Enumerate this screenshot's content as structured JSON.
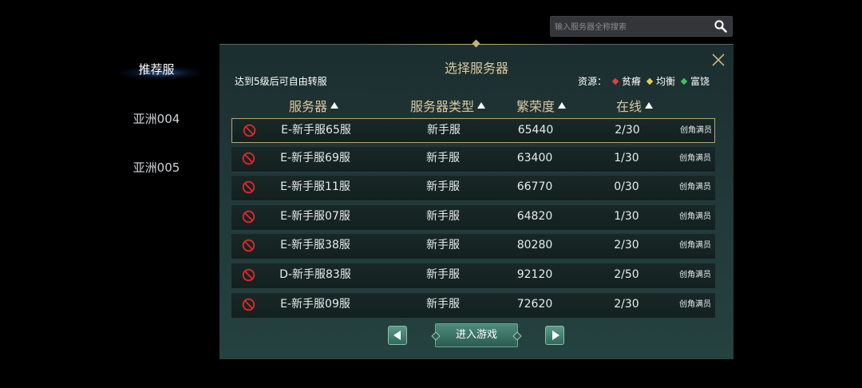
{
  "search": {
    "placeholder": "输入服务器全称搜索",
    "value": ""
  },
  "tabs": [
    {
      "label": "推荐服",
      "active": true
    },
    {
      "label": "亚洲004",
      "active": false
    },
    {
      "label": "亚洲005",
      "active": false
    }
  ],
  "panel": {
    "title": "选择服务器",
    "transfer_note": "达到5级后可自由转服",
    "legend": {
      "label": "资源：",
      "items": [
        {
          "label": "贫瘠",
          "color": "#e04040"
        },
        {
          "label": "均衡",
          "color": "#e0d050"
        },
        {
          "label": "富饶",
          "color": "#40c060"
        }
      ]
    },
    "columns": [
      "服务器",
      "服务器类型",
      "繁荣度",
      "在线"
    ],
    "rows": [
      {
        "name": "E-新手服65服",
        "type": "新手服",
        "prosperity": "65440",
        "online": "2/30",
        "status": "创角满员"
      },
      {
        "name": "E-新手服69服",
        "type": "新手服",
        "prosperity": "63400",
        "online": "1/30",
        "status": "创角满员"
      },
      {
        "name": "E-新手服11服",
        "type": "新手服",
        "prosperity": "66770",
        "online": "0/30",
        "status": "创角满员"
      },
      {
        "name": "E-新手服07服",
        "type": "新手服",
        "prosperity": "64820",
        "online": "1/30",
        "status": "创角满员"
      },
      {
        "name": "E-新手服38服",
        "type": "新手服",
        "prosperity": "80280",
        "online": "2/30",
        "status": "创角满员"
      },
      {
        "name": "D-新手服83服",
        "type": "新手服",
        "prosperity": "92120",
        "online": "2/50",
        "status": "创角满员"
      },
      {
        "name": "E-新手服09服",
        "type": "新手服",
        "prosperity": "72620",
        "online": "2/30",
        "status": "创角满员"
      }
    ],
    "enter_label": "进入游戏"
  },
  "colors": {
    "accent_gold": "#d9c7a2",
    "ban_red": "#e02828",
    "button_green": "#3f7a68"
  }
}
